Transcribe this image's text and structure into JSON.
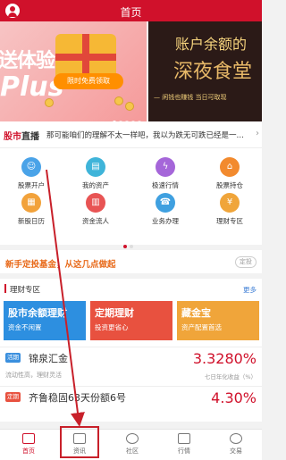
{
  "header": {
    "title": "首页"
  },
  "banner": {
    "left_big": "送体验",
    "left_plus": "Plus",
    "left_button": "限时免费领取",
    "right_title": "账户余额的",
    "right_big": "深夜食堂",
    "right_sub": "— 闲钱也赚钱  当日可取现"
  },
  "ticker": {
    "logo_a": "股市",
    "logo_b": "直播",
    "text": "那可能咱们的理解不太一样吧，我以为跌无可跌已经是一…"
  },
  "shortcuts": [
    {
      "label": "股票开户",
      "icon": "user-icon",
      "color": "#4aa3e8"
    },
    {
      "label": "我的资产",
      "icon": "wallet-icon",
      "color": "#3fb4d9"
    },
    {
      "label": "极速行情",
      "icon": "lightning-icon",
      "color": "#a566d9"
    },
    {
      "label": "股票持仓",
      "icon": "home-chart-icon",
      "color": "#f28a2e"
    },
    {
      "label": "新股日历",
      "icon": "calendar-icon",
      "color": "#f2a23b"
    },
    {
      "label": "资金流人",
      "icon": "fund-icon",
      "color": "#e85454"
    },
    {
      "label": "业务办理",
      "icon": "service-icon",
      "color": "#3fa0e0"
    },
    {
      "label": "理财专区",
      "icon": "finance-icon",
      "color": "#f0a53a"
    }
  ],
  "promo": {
    "text": "新手定投基金，从这几点做起",
    "tag": "定投"
  },
  "finance": {
    "title": "理财专区",
    "more": "更多",
    "cards": [
      {
        "title": "股市余额理财",
        "sub": "资金不闲置",
        "color": "#2d8fe0"
      },
      {
        "title": "定期理财",
        "sub": "投资更省心",
        "color": "#e8513f"
      },
      {
        "title": "藏金宝",
        "sub": "资产配置首选",
        "color": "#f0a53a"
      }
    ],
    "products": [
      {
        "tag": "活期",
        "tag_color": "#3a8fde",
        "name": "锦泉汇金",
        "desc": "流动性高，理财灵活",
        "rate": "3.3280%",
        "rate_desc": "七日年化收益（%）"
      },
      {
        "tag": "定期",
        "tag_color": "#e8513f",
        "name": "齐鲁稳固63天份额6号",
        "desc": "",
        "rate": "4.30%",
        "rate_desc": ""
      }
    ]
  },
  "nav": [
    {
      "label": "首页",
      "icon": "home-icon",
      "active": true
    },
    {
      "label": "资讯",
      "icon": "news-icon",
      "active": false
    },
    {
      "label": "社区",
      "icon": "community-icon",
      "active": false
    },
    {
      "label": "行情",
      "icon": "market-icon",
      "active": false
    },
    {
      "label": "交易",
      "icon": "trade-icon",
      "active": false
    }
  ],
  "colors": {
    "brand": "#d0112b",
    "annotation": "#c8202a"
  }
}
